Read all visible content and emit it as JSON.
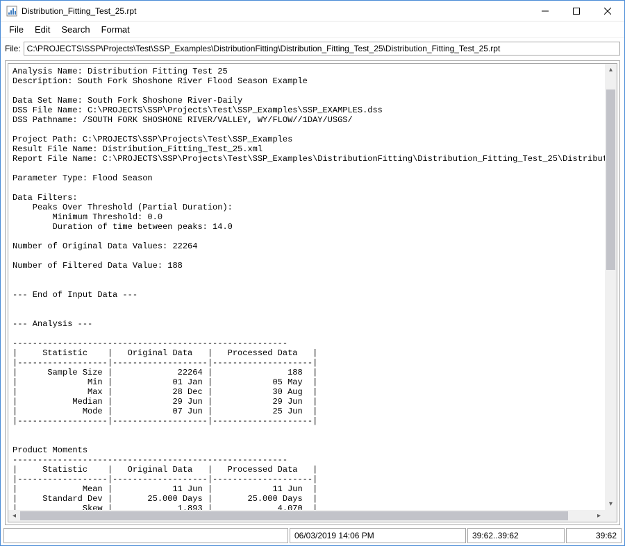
{
  "window": {
    "title": "Distribution_Fitting_Test_25.rpt"
  },
  "menu": {
    "file": "File",
    "edit": "Edit",
    "search": "Search",
    "format": "Format"
  },
  "file_row": {
    "label": "File:",
    "path": "C:\\PROJECTS\\SSP\\Projects\\Test\\SSP_Examples\\DistributionFitting\\Distribution_Fitting_Test_25\\Distribution_Fitting_Test_25.rpt"
  },
  "report": {
    "text": "Analysis Name: Distribution Fitting Test 25\nDescription: South Fork Shoshone River Flood Season Example\n\nData Set Name: South Fork Shoshone River-Daily\nDSS File Name: C:\\PROJECTS\\SSP\\Projects\\Test\\SSP_Examples\\SSP_EXAMPLES.dss\nDSS Pathname: /SOUTH FORK SHOSHONE RIVER/VALLEY, WY/FLOW//1DAY/USGS/\n\nProject Path: C:\\PROJECTS\\SSP\\Projects\\Test\\SSP_Examples\nResult File Name: Distribution_Fitting_Test_25.xml\nReport File Name: C:\\PROJECTS\\SSP\\Projects\\Test\\SSP_Examples\\DistributionFitting\\Distribution_Fitting_Test_25\\Distribution_Fitt\n\nParameter Type: Flood Season\n\nData Filters:\n    Peaks Over Threshold (Partial Duration):\n        Minimum Threshold: 0.0\n        Duration of time between peaks: 14.0\n\nNumber of Original Data Values: 22264\n\nNumber of Filtered Data Value: 188\n\n\n--- End of Input Data ---\n\n\n--- Analysis ---\n\n-------------------------------------------------------\n|     Statistic    |   Original Data   |   Processed Data   |\n|------------------|-------------------|--------------------|\n|      Sample Size |             22264 |               188  |\n|              Min |            01 Jan |            05 May  |\n|              Max |            28 Dec |            30 Aug  |\n|           Median |            29 Jun |            29 Jun  |\n|             Mode |            07 Jun |            25 Jun  |\n|------------------|-------------------|--------------------|\n\n\nProduct Moments\n-------------------------------------------------------\n|     Statistic    |   Original Data   |   Processed Data   |\n|------------------|-------------------|--------------------|\n|             Mean |            11 Jun |            11 Jun  |\n|     Standard Dev |       25.000 Days |       25.000 Days  |\n|             Skew |             1.893 |             4.070  |"
  },
  "status": {
    "datetime": "06/03/2019 14:06 PM",
    "range": "39:62..39:62",
    "pos": "39:62"
  }
}
